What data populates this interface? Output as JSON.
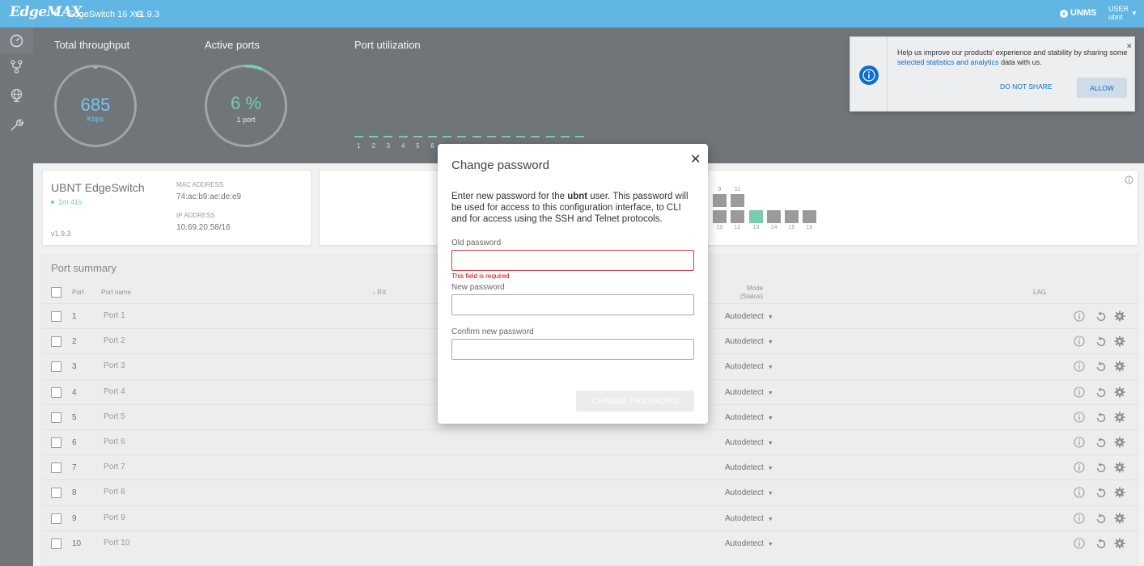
{
  "header": {
    "brand": "EdgeMAX",
    "model": "EdgeSwitch 16 XG",
    "version": "v1.9.3",
    "unms": "UNMS",
    "user_label": "USER",
    "user_name": "ubnt"
  },
  "sidebar": {
    "icons": [
      "dashboard-icon",
      "vlan-icon",
      "routing-icon",
      "tools-icon"
    ]
  },
  "dashboard": {
    "throughput_label": "Total throughput",
    "throughput_value": "685",
    "throughput_unit": "Kbps",
    "active_label": "Active ports",
    "active_value": "6 %",
    "active_sub": "1 port",
    "active_fraction": 0.06,
    "util_label": "Port utilization",
    "util_numbers": [
      "1",
      "2",
      "3",
      "4",
      "5",
      "6"
    ]
  },
  "device": {
    "name": "UBNT EdgeSwitch",
    "uptime": "1m 41s",
    "firmware": "v1.9.3",
    "mac_label": "MAC ADDRESS",
    "mac": "74:ac:b9:ae:de:e9",
    "ip_label": "IP ADDRESS",
    "ip": "10.69.20.58/16"
  },
  "port_panel": {
    "top_numbers": [
      "9",
      "11"
    ],
    "bottom_numbers": [
      "10",
      "12",
      "13",
      "14",
      "15",
      "16"
    ]
  },
  "summary": {
    "title": "Port summary",
    "headers": {
      "port": "Port",
      "name": "Port name",
      "rx": "↓ RX",
      "mode": "Mode",
      "mode_sub": "(Status)",
      "lag": "LAG"
    },
    "rows": [
      {
        "num": "1",
        "name": "Port 1",
        "mode": "Autodetect"
      },
      {
        "num": "2",
        "name": "Port 2",
        "mode": "Autodetect"
      },
      {
        "num": "3",
        "name": "Port 3",
        "mode": "Autodetect"
      },
      {
        "num": "4",
        "name": "Port 4",
        "mode": "Autodetect"
      },
      {
        "num": "5",
        "name": "Port 5",
        "mode": "Autodetect"
      },
      {
        "num": "6",
        "name": "Port 6",
        "mode": "Autodetect"
      },
      {
        "num": "7",
        "name": "Port 7",
        "mode": "Autodetect"
      },
      {
        "num": "8",
        "name": "Port 8",
        "mode": "Autodetect"
      },
      {
        "num": "9",
        "name": "Port 9",
        "mode": "Autodetect"
      },
      {
        "num": "10",
        "name": "Port 10",
        "mode": "Autodetect"
      }
    ]
  },
  "modal": {
    "title": "Change password",
    "desc_before": "Enter new password for the ",
    "desc_user": "ubnt",
    "desc_after": " user. This password will be used for access to this configuration interface, to CLI and for access using the SSH and Telnet protocols.",
    "old_label": "Old password",
    "old_error": "This field is required",
    "new_label": "New password",
    "confirm_label": "Confirm new password",
    "submit": "CHANGE PASSWORD"
  },
  "toast": {
    "text_before": "Help us improve our products' experience and stability by sharing some ",
    "link": "selected statistics and analytics",
    "text_after": " data with us.",
    "deny": "DO NOT SHARE",
    "allow": "ALLOW"
  },
  "colors": {
    "accent": "#0d8fd6",
    "status_green": "#2fb383",
    "error": "#d10000"
  }
}
